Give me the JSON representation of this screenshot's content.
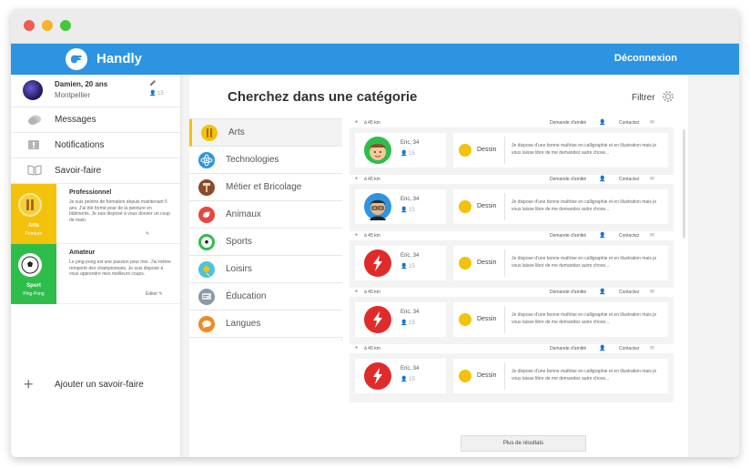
{
  "app": {
    "name": "Handly",
    "logout": "Déconnexion"
  },
  "profile": {
    "name": "Damien, 20 ans",
    "city": "Montpellier",
    "friends": "15"
  },
  "menu": [
    {
      "label": "Messages",
      "icon": "chat-icon"
    },
    {
      "label": "Notifications",
      "icon": "notification-icon"
    },
    {
      "label": "Savoir-faire",
      "icon": "book-icon"
    }
  ],
  "skills": [
    {
      "category": "Arts",
      "sub": "Peinture",
      "level": "Professionnel",
      "desc": "Je suis peintre de formation depuis maintenant 5 ans. J'ai été formé pour de la peinture en bâtiments. Je suis disposé à vous donner un coup de main.",
      "color": "#f2c20c"
    },
    {
      "category": "Sport",
      "sub": "Ping-Pong",
      "level": "Amateur",
      "desc": "Le ping-pong est une passion pour moi. J'ai même remporté des championnats. Je suis disposé à vous apprendre mes meilleurs coups.",
      "color": "#2ebd4b",
      "edit_label": "Éditer"
    }
  ],
  "add_skill": "Ajouter un savoir-faire",
  "main": {
    "title": "Cherchez dans une catégorie",
    "filter": "Filtrer"
  },
  "categories": [
    {
      "label": "Arts",
      "color": "#f2c20c",
      "icon": "pencil-icon"
    },
    {
      "label": "Technologies",
      "color": "#2d94e2",
      "icon": "atom-icon"
    },
    {
      "label": "Métier et Bricolage",
      "color": "#8b4a2b",
      "icon": "hammer-icon"
    },
    {
      "label": "Animaux",
      "color": "#e8473f",
      "icon": "bird-icon"
    },
    {
      "label": "Sports",
      "color": "#2ebd4b",
      "icon": "ball-icon"
    },
    {
      "label": "Loisirs",
      "color": "#4ec3d9",
      "icon": "kite-icon"
    },
    {
      "label": "Éducation",
      "color": "#8c9aa6",
      "icon": "board-icon"
    },
    {
      "label": "Langues",
      "color": "#f08a24",
      "icon": "speech-icon"
    }
  ],
  "results": [
    {
      "distance": "à 45 km",
      "friend": "Demande d'amitié",
      "contact": "Contactez",
      "user": "Eric, 34",
      "friends": "15",
      "skill": "Dessin",
      "text": "Je dispose d'une bonne maîtrise en calligraphie et en illustration mais je vous laisse libre de me demandez autre chose...",
      "avatar": "boy"
    },
    {
      "distance": "à 45 km",
      "friend": "Demande d'amitié",
      "contact": "Contactez",
      "user": "Eric, 34",
      "friends": "15",
      "skill": "Dessin",
      "text": "Je dispose d'une bonne maîtrise en calligraphie et en illustration mais je vous laisse libre de me demandez autre chose...",
      "avatar": "man"
    },
    {
      "distance": "à 45 km",
      "friend": "Demande d'amitié",
      "contact": "Contactez",
      "user": "Eric, 34",
      "friends": "15",
      "skill": "Dessin",
      "text": "Je dispose d'une bonne maîtrise en calligraphie et en illustration mais je vous laisse libre de me demandez autre chose...",
      "avatar": "flash"
    },
    {
      "distance": "à 45 km",
      "friend": "Demande d'amitié",
      "contact": "Contactez",
      "user": "Eric, 34",
      "friends": "15",
      "skill": "Dessin",
      "text": "Je dispose d'une bonne maîtrise en calligraphie et en illustration mais je vous laisse libre de me demandez autre chose...",
      "avatar": "flash"
    },
    {
      "distance": "à 45 km",
      "friend": "Demande d'amitié",
      "contact": "Contactez",
      "user": "Eric, 34",
      "friends": "15",
      "skill": "Dessin",
      "text": "Je dispose d'une bonne maîtrise en calligraphie et en illustration mais je vous laisse libre de me demandez autre chose...",
      "avatar": "flash"
    }
  ],
  "more_results": "Plus de résultats"
}
